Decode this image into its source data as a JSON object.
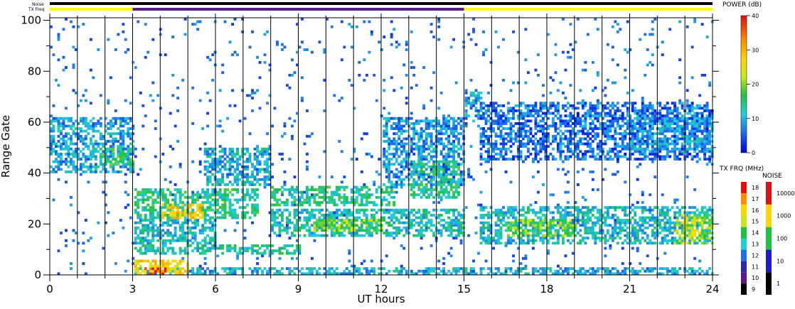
{
  "chart_data": {
    "type": "heatmap",
    "xlabel": "UT hours",
    "ylabel": "Range Gate",
    "xlim": [
      0,
      24
    ],
    "ylim": [
      0,
      101
    ],
    "x_ticks": [
      "0",
      "3",
      "6",
      "9",
      "12",
      "15",
      "18",
      "21",
      "24"
    ],
    "y_ticks": [
      "0",
      "20",
      "40",
      "60",
      "80",
      "100"
    ],
    "vertical_scan_lines_every_hours": 1,
    "status_bars": {
      "noise_label": "Noise",
      "txfreq_label": "TX Freq",
      "noise_color": "#000000",
      "txfreq_segments": [
        {
          "start": 0,
          "end": 3,
          "color": "#ffff00"
        },
        {
          "start": 3,
          "end": 15,
          "color": "#5a1a8c"
        },
        {
          "start": 15,
          "end": 24,
          "color": "#ffff00"
        }
      ]
    },
    "power_colorbar": {
      "label": "POWER (dB)",
      "min": 0,
      "max": 40,
      "ticks": [
        "0",
        "10",
        "20",
        "30",
        "40"
      ]
    },
    "txfreq_colorbar": {
      "label": "TX FRQ (MHz)",
      "ticks": [
        "9",
        "10",
        "11",
        "12",
        "13",
        "14",
        "15",
        "16",
        "17",
        "18"
      ],
      "colors": [
        "#000000",
        "#5a1a8c",
        "#2a2ab0",
        "#1f6fe8",
        "#20d0d0",
        "#20c040",
        "#c8e620",
        "#ffd700",
        "#ff8c00",
        "#e01010"
      ]
    },
    "noise_colorbar": {
      "label": "NOISE",
      "ticks": [
        "1",
        "10",
        "100",
        "1000",
        "10000"
      ],
      "colors": [
        "#000000",
        "#1a1ae0",
        "#20c040",
        "#ffd700",
        "#e01010"
      ]
    },
    "echo_regions": [
      {
        "x0": 0.0,
        "x1": 3.0,
        "g0": 40,
        "g1": 62,
        "power": 9
      },
      {
        "x0": 1.8,
        "x1": 3.0,
        "g0": 43,
        "g1": 50,
        "power": 15
      },
      {
        "x0": 3.0,
        "x1": 7.5,
        "g0": 22,
        "g1": 34,
        "power": 14
      },
      {
        "x0": 4.0,
        "x1": 5.5,
        "g0": 22,
        "g1": 28,
        "power": 28
      },
      {
        "x0": 5.5,
        "x1": 8.0,
        "g0": 35,
        "g1": 50,
        "power": 10
      },
      {
        "x0": 3.0,
        "x1": 6.0,
        "g0": 12,
        "g1": 22,
        "power": 11
      },
      {
        "x0": 3.0,
        "x1": 9.0,
        "g0": 8,
        "g1": 12,
        "power": 13
      },
      {
        "x0": 3.0,
        "x1": 5.0,
        "g0": 0,
        "g1": 6,
        "power": 26
      },
      {
        "x0": 3.3,
        "x1": 4.2,
        "g0": 0,
        "g1": 3,
        "power": 36
      },
      {
        "x0": 8.0,
        "x1": 12.5,
        "g0": 27,
        "g1": 35,
        "power": 14
      },
      {
        "x0": 8.0,
        "x1": 15.0,
        "g0": 15,
        "g1": 26,
        "power": 12
      },
      {
        "x0": 9.5,
        "x1": 12.0,
        "g0": 17,
        "g1": 22,
        "power": 20
      },
      {
        "x0": 12.0,
        "x1": 15.0,
        "g0": 35,
        "g1": 62,
        "power": 8
      },
      {
        "x0": 13.0,
        "x1": 14.8,
        "g0": 30,
        "g1": 45,
        "power": 14
      },
      {
        "x0": 3.0,
        "x1": 24.0,
        "g0": 0,
        "g1": 3,
        "power": 10
      },
      {
        "x0": 15.0,
        "x1": 15.6,
        "g0": 60,
        "g1": 72,
        "power": 9
      },
      {
        "x0": 15.5,
        "x1": 24.0,
        "g0": 12,
        "g1": 27,
        "power": 11
      },
      {
        "x0": 16.5,
        "x1": 19.0,
        "g0": 15,
        "g1": 22,
        "power": 19
      },
      {
        "x0": 22.5,
        "x1": 24.0,
        "g0": 12,
        "g1": 24,
        "power": 22
      },
      {
        "x0": 15.5,
        "x1": 24.0,
        "g0": 45,
        "g1": 68,
        "power": 6
      },
      {
        "x0": 21.0,
        "x1": 24.0,
        "g0": 48,
        "g1": 62,
        "power": 9
      }
    ],
    "sparse_noise_density": 0.035,
    "title": ""
  }
}
